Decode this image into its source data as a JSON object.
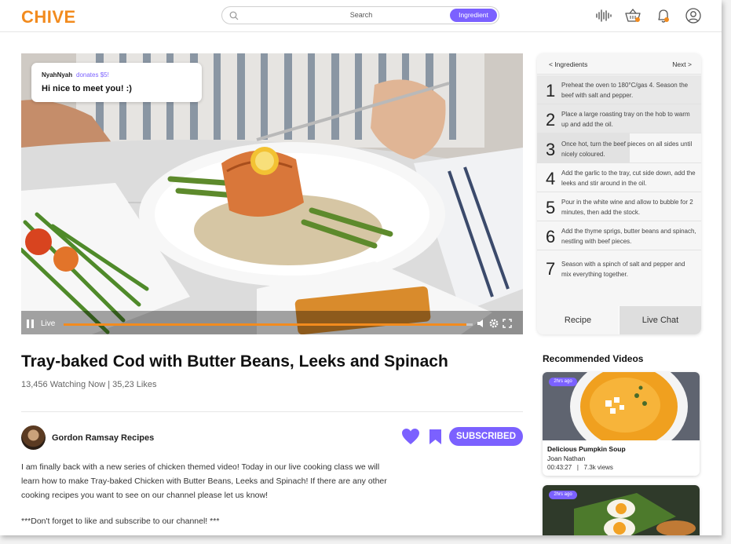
{
  "app": {
    "logo": "CHIVE"
  },
  "search": {
    "placeholder": "Search",
    "mode_label": "Ingredient"
  },
  "header_icons": [
    "audio-wave-icon",
    "basket-icon",
    "bell-icon",
    "profile-icon"
  ],
  "video": {
    "chat": {
      "user": "NyahNyah",
      "donation": "donates $5!",
      "message": "Hi nice to meet you! :)"
    },
    "live_label": "Live",
    "progress": 0.985
  },
  "recipe_title": "Tray-baked Cod with Butter Beans, Leeks and Spinach",
  "stats": "13,456 Watching Now | 35,23 Likes",
  "channel": {
    "name": "Gordon Ramsay Recipes",
    "subscribe_label": "SUBSCRIBED"
  },
  "description": {
    "body": "I am finally back with a new series of chicken themed video! Today in our live cooking class we will learn how to make Tray-baked Chicken with Butter Beans, Leeks and Spinach! If there are any other cooking recipes you want to see on our channel please let us know!",
    "note": "***Don't forget to like and subscribe to our channel! ***"
  },
  "recipe_panel": {
    "prev_label": "< Ingredients",
    "next_label": "Next >",
    "steps": [
      {
        "num": "1",
        "text": "Preheat the oven to 180°C/gas 4. Season the beef with salt and pepper."
      },
      {
        "num": "2",
        "text": "Place a large roasting tray on the hob to warm up and add the oil."
      },
      {
        "num": "3",
        "text": "Once hot, turn the beef pieces on all sides until nicely coloured."
      },
      {
        "num": "4",
        "text": "Add the garlic to the tray, cut side down, add the leeks and stir around in the oil."
      },
      {
        "num": "5",
        "text": "Pour in the white wine and allow to bubble for 2 minutes, then add the stock."
      },
      {
        "num": "6",
        "text": "Add the thyme sprigs, butter beans and spinach, nestling with beef pieces."
      },
      {
        "num": "7",
        "text": "Season with a spinch of salt and pepper and mix everything together."
      }
    ],
    "tabs": [
      "Recipe",
      "Live Chat"
    ]
  },
  "recommended": {
    "title": "Recommended Videos",
    "videos": [
      {
        "badge": "2hrs ago",
        "name": "Delicious Pumpkin Soup",
        "author": "Joan Nathan",
        "duration": "00:43:27",
        "views": "7.3k views"
      },
      {
        "badge": "2hrs ago"
      }
    ]
  },
  "colors": {
    "accent": "#7b61ff",
    "brand": "#f28b1e"
  }
}
